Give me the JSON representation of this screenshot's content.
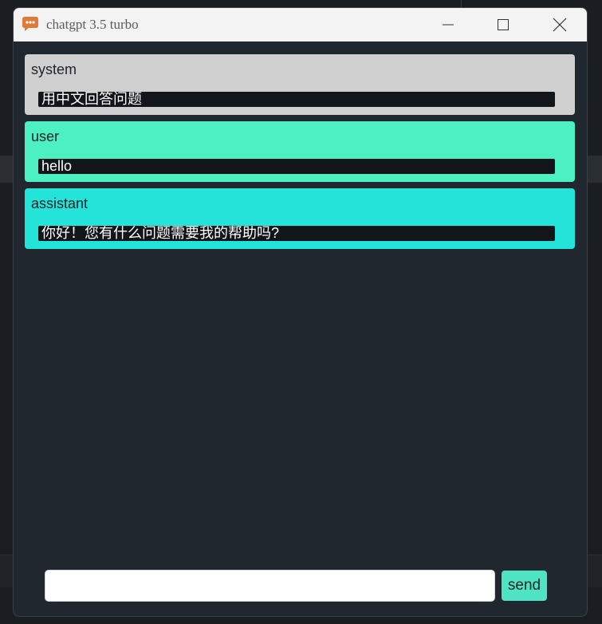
{
  "window": {
    "title": "chatgpt 3.5 turbo",
    "icon": "chat-bubble-icon"
  },
  "messages": [
    {
      "role": "system",
      "content": "用中文回答问题",
      "color": "#cfcfcf"
    },
    {
      "role": "user",
      "content": "hello",
      "color": "#4cf0c1"
    },
    {
      "role": "assistant",
      "content": "你好！您有什么问题需要我的帮助吗?",
      "color": "#24e4da"
    }
  ],
  "composer": {
    "input_value": "",
    "send_label": "send"
  },
  "colors": {
    "window_bg": "#21272e",
    "titlebar_bg": "#f3f3f3",
    "send_button": "#4ee3c3",
    "icon_accent": "#e07a3a"
  }
}
